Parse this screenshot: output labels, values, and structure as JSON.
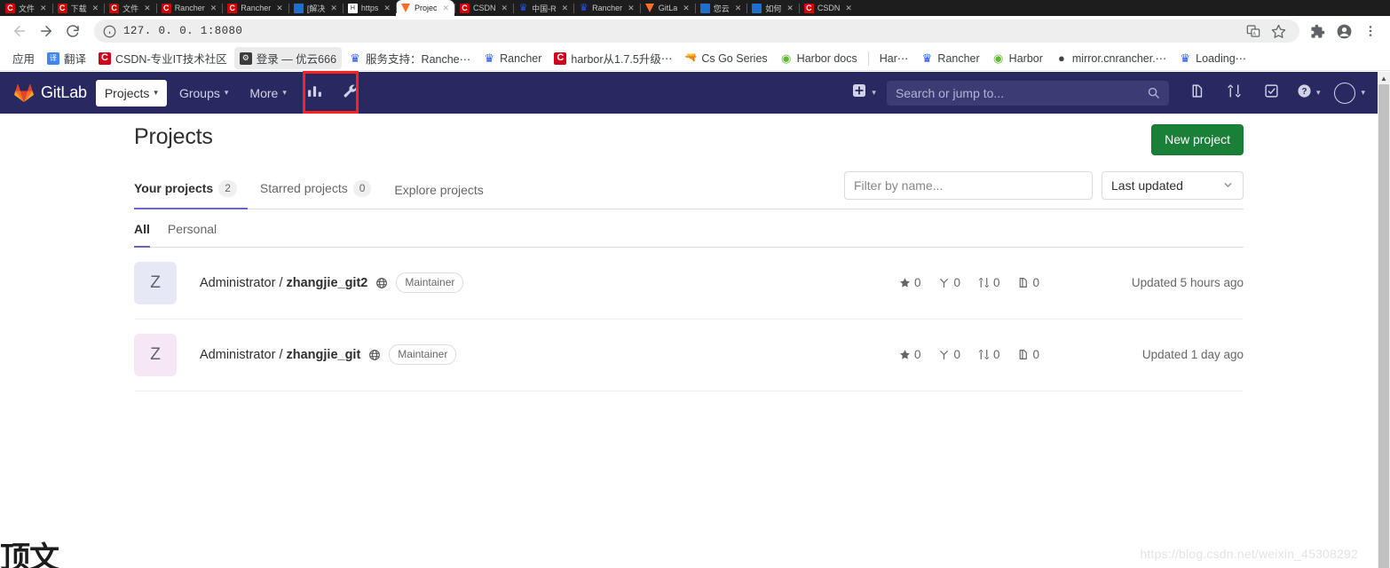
{
  "browser": {
    "tabs": [
      {
        "title": "文件",
        "favicon": "csdn-icon"
      },
      {
        "title": "下载",
        "favicon": "csdn-icon"
      },
      {
        "title": "文件",
        "favicon": "csdn-icon"
      },
      {
        "title": "Rancher",
        "favicon": "csdn-icon"
      },
      {
        "title": "Rancher",
        "favicon": "csdn-icon"
      },
      {
        "title": "[解决",
        "favicon": "blue-square-icon"
      },
      {
        "title": "https",
        "favicon": "white-square-icon"
      },
      {
        "title": "Projec",
        "favicon": "gitlab-icon",
        "active": true
      },
      {
        "title": "CSDN",
        "favicon": "csdn-icon"
      },
      {
        "title": "中国-R",
        "favicon": "rancher-icon"
      },
      {
        "title": "Rancher",
        "favicon": "rancher-icon"
      },
      {
        "title": "GitLa",
        "favicon": "gitlab-icon"
      },
      {
        "title": "您云",
        "favicon": "blue-square-icon"
      },
      {
        "title": "如何",
        "favicon": "blue-square-icon"
      },
      {
        "title": "CSDN",
        "favicon": "csdn-icon"
      }
    ],
    "url": "127. 0. 0. 1:8080",
    "close_glyph": "✕",
    "forward_glyph": "→",
    "reload_glyph": "⟳",
    "info_glyph": "ⓘ"
  },
  "bookmarks": [
    {
      "label": "应用",
      "icon": "apps-icon",
      "icon_type": "none"
    },
    {
      "label": "翻译",
      "icon": "translate-icon",
      "icon_type": "trans"
    },
    {
      "label": "CSDN-专业IT技术社区",
      "icon": "csdn-icon",
      "icon_type": "csdn"
    },
    {
      "label": "登录 — 优云666",
      "icon": "login-icon",
      "icon_type": "dark",
      "hovered": true
    },
    {
      "label": "服务支持：Ranche⋯",
      "icon": "rancher-icon",
      "icon_type": "rancher"
    },
    {
      "label": "Rancher",
      "icon": "rancher-icon",
      "icon_type": "rancher"
    },
    {
      "label": "harbor从1.7.5升级⋯",
      "icon": "csdn-icon",
      "icon_type": "csdn"
    },
    {
      "label": "Cs Go Series",
      "icon": "gun-icon",
      "icon_type": "gun"
    },
    {
      "label": "Harbor docs",
      "icon": "harbor-icon",
      "icon_type": "harbor"
    },
    {
      "label": "Har⋯",
      "icon": "harbor-icon",
      "icon_type": "none"
    },
    {
      "label": "Rancher",
      "icon": "rancher-icon",
      "icon_type": "rancher"
    },
    {
      "label": "Harbor",
      "icon": "harbor-icon",
      "icon_type": "harbor"
    },
    {
      "label": "mirror.cnrancher.⋯",
      "icon": "mirror-icon",
      "icon_type": "mirror"
    },
    {
      "label": "Loading⋯",
      "icon": "rancher-icon",
      "icon_type": "rancher"
    }
  ],
  "gitlab_nav": {
    "brand": "GitLab",
    "projects_label": "Projects",
    "groups_label": "Groups",
    "more_label": "More",
    "analytics_icon": "chart-bar-icon",
    "admin_icon": "wrench-icon",
    "plus_icon": "plus-square-icon",
    "search_placeholder": "Search or jump to...",
    "search_icon": "search-icon",
    "snippets_icon": "snippet-icon",
    "merge_requests_icon": "merge-request-icon",
    "todos_icon": "todo-check-icon",
    "help_icon": "help-question-icon",
    "avatar_icon": "user-avatar-icon"
  },
  "main": {
    "title": "Projects",
    "new_project_button": "New project",
    "tabs": [
      {
        "label": "Your projects",
        "count": "2",
        "active": true
      },
      {
        "label": "Starred projects",
        "count": "0",
        "active": false
      },
      {
        "label": "Explore projects",
        "count": "",
        "active": false
      }
    ],
    "filter_placeholder": "Filter by name...",
    "sort_value": "Last updated",
    "subtabs": [
      {
        "label": "All",
        "active": true
      },
      {
        "label": "Personal",
        "active": false
      }
    ],
    "projects": [
      {
        "avatar_letter": "Z",
        "avatar_color": "#e6e9f5",
        "namespace": "Administrator / ",
        "name": "zhangjie_git2",
        "visibility_icon": "globe-public-icon",
        "role": "Maintainer",
        "stars": "0",
        "forks": "0",
        "merge_requests": "0",
        "issues": "0",
        "updated": "Updated 5 hours ago"
      },
      {
        "avatar_letter": "Z",
        "avatar_color": "#f6e7f4",
        "namespace": "Administrator / ",
        "name": "zhangjie_git",
        "visibility_icon": "globe-public-icon",
        "role": "Maintainer",
        "stars": "0",
        "forks": "0",
        "merge_requests": "0",
        "issues": "0",
        "updated": "Updated 1 day ago"
      }
    ]
  },
  "overlay": {
    "watermark": "https://blog.csdn.net/weixin_45308292",
    "corner_text": "顶文"
  },
  "colors": {
    "navbar": "#292961",
    "primary_button": "#1a7f37",
    "tab_active_underline": "#6666c4",
    "highlight_box": "#ff2020"
  }
}
